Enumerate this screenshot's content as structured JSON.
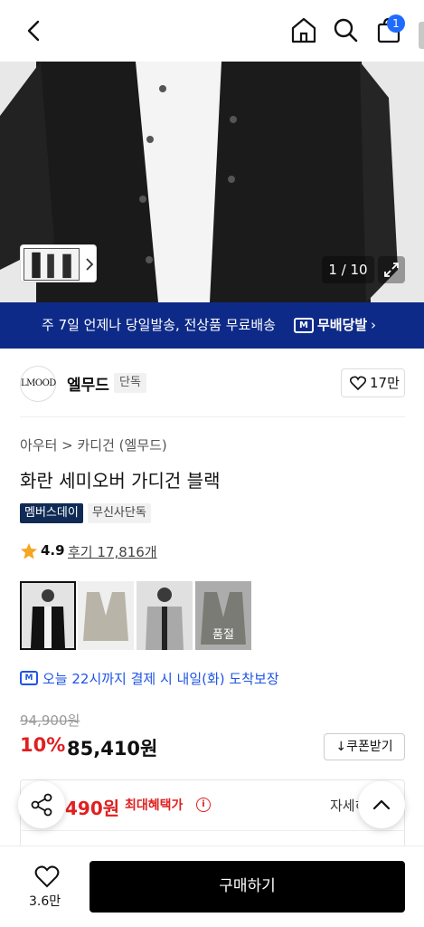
{
  "header": {
    "cart_count": "1",
    "icons": [
      "back-arrow-icon",
      "home-icon",
      "search-icon",
      "cart-icon"
    ]
  },
  "gallery": {
    "counter": "1 / 10"
  },
  "banner": {
    "text": "주 7일 언제나 당일발송, 전상품 무료배송",
    "logo_mark": "M",
    "service": "무배당발",
    "arrow": "›"
  },
  "brand": {
    "logo_text": "LMOOD",
    "name": "엘무드",
    "tag": "단독",
    "likes": "17만"
  },
  "product": {
    "breadcrumb": "아우터 > 카디건 (엘무드)",
    "title": "화란 세미오버 가디건 블랙",
    "badge_member": "멤버스데이",
    "badge_exclusive": "무신사단독",
    "rating": "4.9",
    "reviews": "후기 17,816개",
    "sold_out_label": "품절"
  },
  "delivery": {
    "logo_mark": "M",
    "text": "오늘 22시까지 결제 시 내일(화) 도착보장"
  },
  "price": {
    "original": "94,900원",
    "discount": "10%",
    "sale": "85,410원",
    "coupon_label": "쿠폰받기",
    "benefit_price": "490원",
    "benefit_label": "최대혜택가",
    "benefit_info": "i",
    "benefit_detail": "자세히"
  },
  "bottom": {
    "wish_count": "3.6만",
    "buy_label": "구매하기"
  },
  "colors": {
    "banner_bg": "#0e2a88",
    "accent_blue": "#1f54e5",
    "sale_red": "#e02020",
    "buy_button": "#000000"
  }
}
